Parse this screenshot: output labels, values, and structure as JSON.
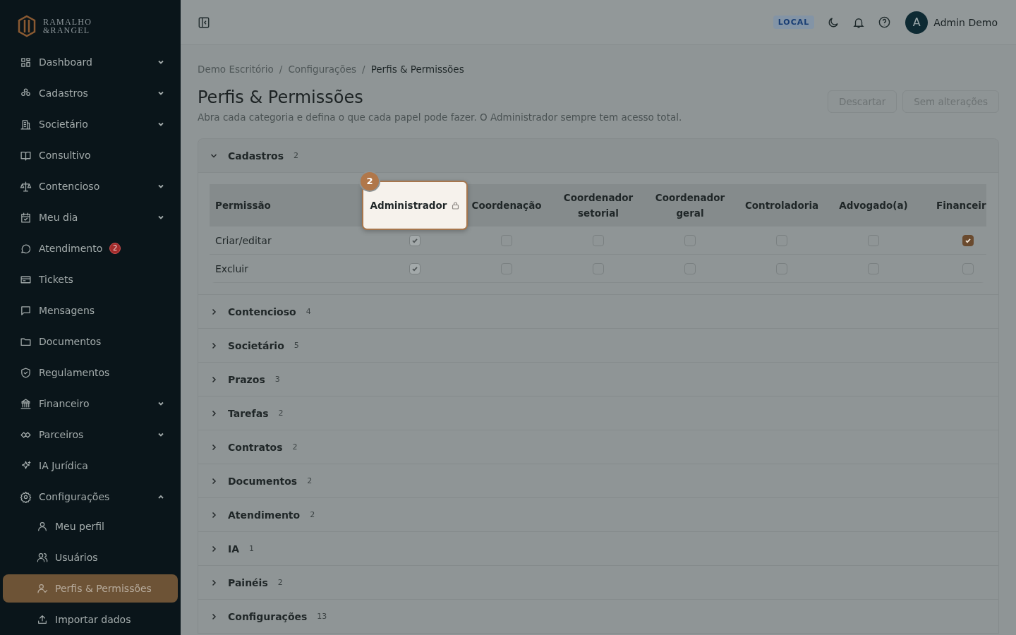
{
  "brand": {
    "line1": "RAMALHO",
    "line2": "&RANGEL"
  },
  "sidebar": {
    "items": [
      {
        "label": "Dashboard",
        "expanded": false
      },
      {
        "label": "Cadastros",
        "expanded": false
      },
      {
        "label": "Societário",
        "expanded": false
      },
      {
        "label": "Consultivo"
      },
      {
        "label": "Contencioso",
        "expanded": false
      },
      {
        "label": "Meu dia",
        "expanded": false
      },
      {
        "label": "Atendimento",
        "badge": "2"
      },
      {
        "label": "Tickets"
      },
      {
        "label": "Mensagens"
      },
      {
        "label": "Documentos"
      },
      {
        "label": "Regulamentos"
      },
      {
        "label": "Financeiro",
        "expanded": false
      },
      {
        "label": "Parceiros",
        "expanded": false
      },
      {
        "label": "IA Jurídica"
      },
      {
        "label": "Configurações",
        "expanded": true,
        "children": [
          {
            "label": "Meu perfil",
            "selected": false
          },
          {
            "label": "Usuários",
            "selected": false
          },
          {
            "label": "Perfis & Permissões",
            "selected": true
          },
          {
            "label": "Importar dados",
            "selected": false
          }
        ]
      }
    ]
  },
  "topbar": {
    "env_badge": "LOCAL",
    "user": {
      "initial": "A",
      "name": "Admin Demo"
    }
  },
  "breadcrumb": {
    "separator": "/",
    "items": [
      "Demo Escritório",
      "Configurações",
      "Perfis & Permissões"
    ]
  },
  "page": {
    "title": "Perfis & Permissões",
    "subtitle": "Abra cada categoria e defina o que cada papel pode fazer. O Administrador sempre tem acesso total.",
    "buttons": [
      {
        "label": "Descartar",
        "disabled": true
      },
      {
        "label": "Sem alterações",
        "disabled": true
      }
    ]
  },
  "tour": {
    "step": "2"
  },
  "sections": [
    {
      "name": "Cadastros",
      "count": "2",
      "expanded": true,
      "table": {
        "columns": [
          {
            "label": "Permissão"
          },
          {
            "label": "Administrador",
            "locked": true,
            "highlighted": true
          },
          {
            "label": "Coordenação"
          },
          {
            "label": "Coordenador setorial"
          },
          {
            "label": "Coordenador geral"
          },
          {
            "label": "Controladoria"
          },
          {
            "label": "Advogado(a)"
          },
          {
            "label": "Financeir"
          }
        ],
        "rows": [
          {
            "permission": "Criar/editar",
            "checks": [
              {
                "checked": true,
                "disabled": true
              },
              {
                "checked": false,
                "disabled": false
              },
              {
                "checked": false,
                "disabled": false
              },
              {
                "checked": false,
                "disabled": false
              },
              {
                "checked": false,
                "disabled": false
              },
              {
                "checked": false,
                "disabled": false
              },
              {
                "checked": true,
                "disabled": false
              }
            ]
          },
          {
            "permission": "Excluir",
            "checks": [
              {
                "checked": true,
                "disabled": true
              },
              {
                "checked": false,
                "disabled": false
              },
              {
                "checked": false,
                "disabled": false
              },
              {
                "checked": false,
                "disabled": false
              },
              {
                "checked": false,
                "disabled": false
              },
              {
                "checked": false,
                "disabled": false
              },
              {
                "checked": false,
                "disabled": false
              }
            ]
          }
        ]
      }
    },
    {
      "name": "Contencioso",
      "count": "4",
      "expanded": false
    },
    {
      "name": "Societário",
      "count": "5",
      "expanded": false
    },
    {
      "name": "Prazos",
      "count": "3",
      "expanded": false
    },
    {
      "name": "Tarefas",
      "count": "2",
      "expanded": false
    },
    {
      "name": "Contratos",
      "count": "2",
      "expanded": false
    },
    {
      "name": "Documentos",
      "count": "2",
      "expanded": false
    },
    {
      "name": "Atendimento",
      "count": "2",
      "expanded": false
    },
    {
      "name": "IA",
      "count": "1",
      "expanded": false
    },
    {
      "name": "Painéis",
      "count": "2",
      "expanded": false
    },
    {
      "name": "Configurações",
      "count": "13",
      "expanded": false
    }
  ]
}
